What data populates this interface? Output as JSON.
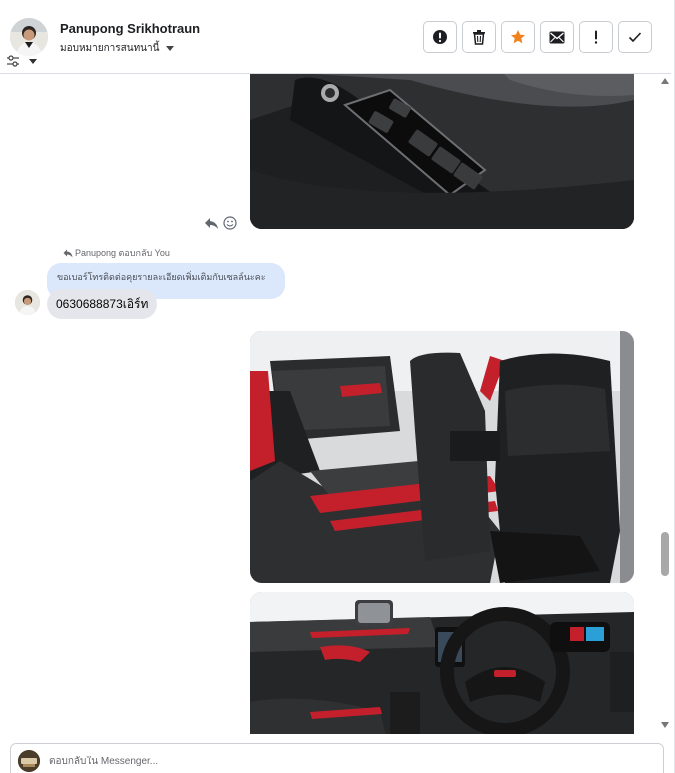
{
  "header": {
    "contact_name": "Panupong Srikhotraun",
    "assign_label": "มอบหมายการสนทนานี้",
    "actions": [
      {
        "name": "mark-spam-button",
        "icon": "exclamation-circle-icon"
      },
      {
        "name": "delete-button",
        "icon": "trash-icon"
      },
      {
        "name": "star-button",
        "icon": "star-icon"
      },
      {
        "name": "mark-unread-button",
        "icon": "envelope-icon"
      },
      {
        "name": "follow-up-button",
        "icon": "exclamation-icon"
      },
      {
        "name": "mark-done-button",
        "icon": "checkmark-icon"
      }
    ]
  },
  "thread": {
    "reply_meta": "Panupong ตอบกลับ You",
    "quoted_message": "ขอเบอร์โทรติดต่อคุยรายละเอียดเพิ่มเติมกับเซลล์นะคะ",
    "customer_message": "0630688873เอิร์ท",
    "images": [
      {
        "name": "car-door-window-switch-photo"
      },
      {
        "name": "car-rear-seats-photo"
      },
      {
        "name": "car-dashboard-steering-photo"
      }
    ]
  },
  "composer": {
    "placeholder": "ตอบกลับใน Messenger..."
  },
  "colors": {
    "accent": "#f0821e",
    "bubble_customer": "#e4e6eb",
    "bubble_quoted": "#dbe7fb"
  }
}
